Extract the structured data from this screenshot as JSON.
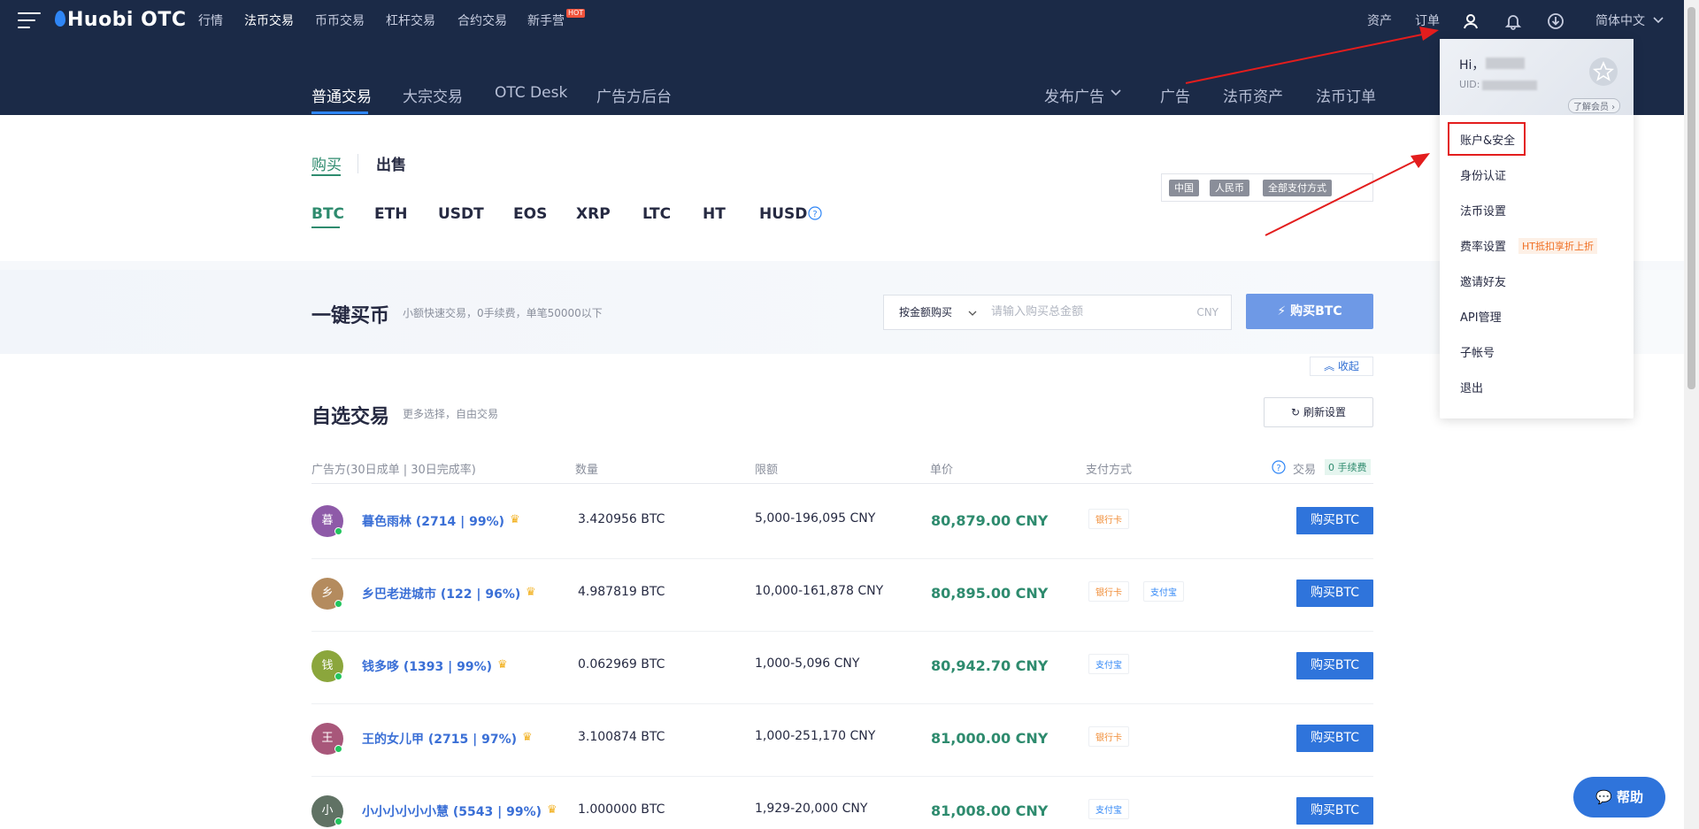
{
  "brand": {
    "name": "Huobi OTC"
  },
  "topnav": {
    "items": [
      "行情",
      "法币交易",
      "币币交易",
      "杠杆交易",
      "合约交易",
      "新手营"
    ],
    "hot": "HOT",
    "right": {
      "assets": "资产",
      "orders": "订单",
      "language": "简体中文"
    }
  },
  "subnav": {
    "left": [
      "普通交易",
      "大宗交易",
      "OTC Desk",
      "广告方后台"
    ],
    "right": [
      "发布广告",
      "广告",
      "法币资产",
      "法币订单"
    ]
  },
  "trade_tabs": {
    "buy": "购买",
    "sell": "出售"
  },
  "coins": [
    "BTC",
    "ETH",
    "USDT",
    "EOS",
    "XRP",
    "LTC",
    "HT",
    "HUSD"
  ],
  "filters": {
    "country": "中国",
    "currency": "人民币",
    "payment": "全部支付方式"
  },
  "quick": {
    "title": "一键买币",
    "hint": "小额快速交易，0手续费，单笔50000以下",
    "select": "按金额购买",
    "placeholder": "请输入购买总金额",
    "unit": "CNY",
    "button": "购买BTC",
    "collapse": "收起"
  },
  "list": {
    "title": "自选交易",
    "hint": "更多选择，自由交易",
    "refresh": "刷新设置",
    "headers": {
      "merchant": "广告方(30日成单 | 30日完成率)",
      "amount": "数量",
      "limit": "限额",
      "price": "单价",
      "payment": "支付方式",
      "trade": "交易",
      "fee": "0 手续费"
    },
    "rows": [
      {
        "initial": "暮",
        "name": "暮色雨林 (2714 | 99%)",
        "amount": "3.420956 BTC",
        "limit": "5,000-196,095 CNY",
        "price": "80,879.00 CNY",
        "pays": [
          "银行卡"
        ],
        "button": "购买BTC",
        "color": "#8e5aa8"
      },
      {
        "initial": "乡",
        "name": "乡巴老进城市 (122 | 96%)",
        "amount": "4.987819 BTC",
        "limit": "10,000-161,878 CNY",
        "price": "80,895.00 CNY",
        "pays": [
          "银行卡",
          "支付宝"
        ],
        "button": "购买BTC",
        "color": "#b48b5e"
      },
      {
        "initial": "钱",
        "name": "钱多哆 (1393 | 99%)",
        "amount": "0.062969 BTC",
        "limit": "1,000-5,096 CNY",
        "price": "80,942.70 CNY",
        "pays": [
          "支付宝"
        ],
        "button": "购买BTC",
        "color": "#8ba63c"
      },
      {
        "initial": "王",
        "name": "王的女儿甲 (2715 | 97%)",
        "amount": "3.100874 BTC",
        "limit": "1,000-251,170 CNY",
        "price": "81,000.00 CNY",
        "pays": [
          "银行卡"
        ],
        "button": "购买BTC",
        "color": "#a8577a"
      },
      {
        "initial": "小",
        "name": "小小小小小小慧 (5543 | 99%)",
        "amount": "1.000000 BTC",
        "limit": "1,929-20,000 CNY",
        "price": "81,008.00 CNY",
        "pays": [
          "支付宝"
        ],
        "button": "购买BTC",
        "color": "#607264"
      }
    ]
  },
  "dropdown": {
    "greeting": "Hi，",
    "uid_label": "UID:",
    "member_link": "了解会员",
    "items": [
      "账户&安全",
      "身份认证",
      "法币设置",
      "费率设置",
      "邀请好友",
      "API管理",
      "子帐号",
      "退出"
    ],
    "fee_promo": "HT抵扣享折上折"
  },
  "help": {
    "label": "帮助"
  },
  "colors": {
    "nav_bg": "#1b2a47",
    "accent_green": "#2e8b6e",
    "accent_blue": "#2f74db",
    "annotation_red": "#e31d1d"
  }
}
